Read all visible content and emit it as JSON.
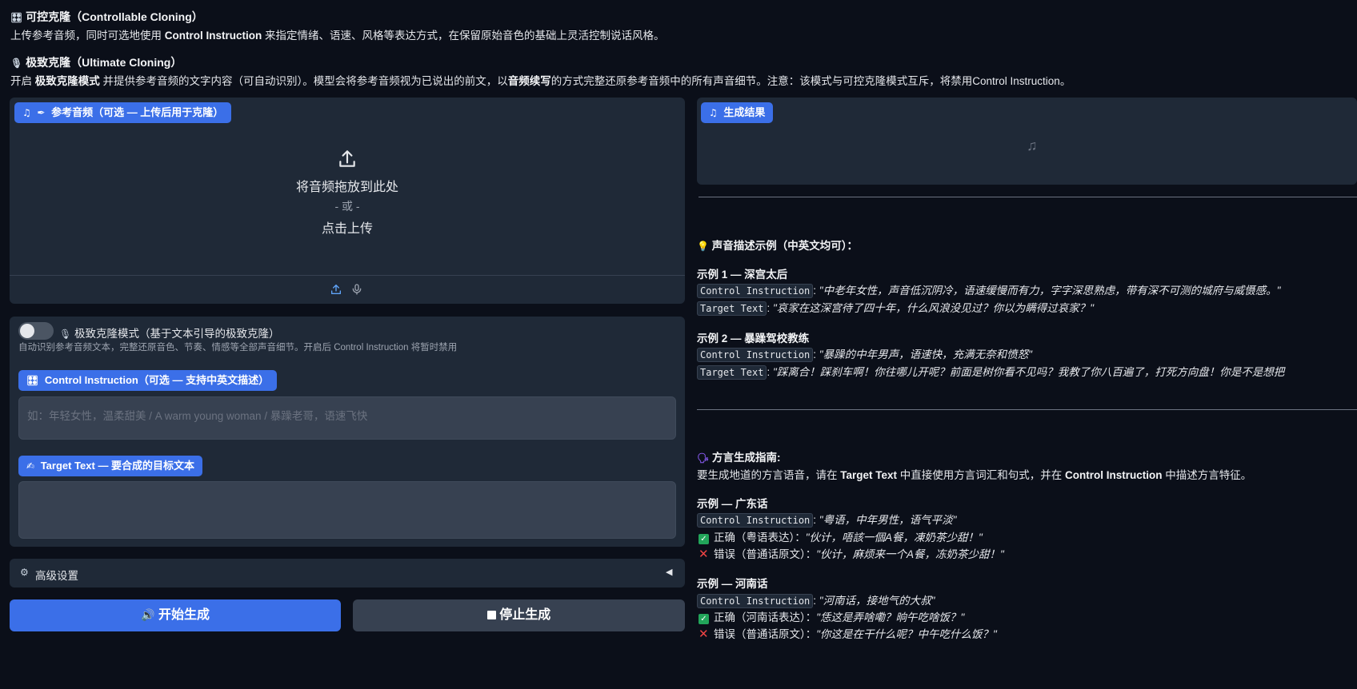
{
  "intro": {
    "controllable_title": "可控克隆（Controllable Cloning）",
    "controllable_desc_pre": "上传参考音频，同时可选地使用 ",
    "controllable_desc_bold": "Control Instruction",
    "controllable_desc_post": " 来指定情绪、语速、风格等表达方式，在保留原始音色的基础上灵活控制说话风格。",
    "ultimate_title": "极致克隆（Ultimate Cloning）",
    "ultimate_desc_pre": "开启 ",
    "ultimate_desc_bold1": "极致克隆模式",
    "ultimate_desc_mid": " 并提供参考音频的文字内容（可自动识别）。模型会将参考音频视为已说出的前文，以",
    "ultimate_desc_bold2": "音频续写",
    "ultimate_desc_post": "的方式完整还原参考音频中的所有声音细节。注意：该模式与可控克隆模式互斥，将禁用Control Instruction。"
  },
  "reference_audio": {
    "label": "参考音频（可选 — 上传后用于克隆）",
    "drop_text": "将音频拖放到此处",
    "or_text": "- 或 -",
    "click_text": "点击上传"
  },
  "ultimate_mode": {
    "label": "极致克隆模式（基于文本引导的极致克隆）",
    "hint": "自动识别参考音频文本，完整还原音色、节奏、情感等全部声音细节。开启后 Control Instruction 将暂时禁用",
    "enabled": false
  },
  "control_instruction": {
    "label": "Control Instruction（可选 — 支持中英文描述）",
    "placeholder": "如：年轻女性，温柔甜美 / A warm young woman / 暴躁老哥，语速飞快"
  },
  "target_text": {
    "label": "Target Text — 要合成的目标文本",
    "value": ""
  },
  "advanced": {
    "label": "高级设置"
  },
  "buttons": {
    "start": "开始生成",
    "stop": "停止生成"
  },
  "result": {
    "label": "生成结果"
  },
  "guide": {
    "examples_title": "声音描述示例（中英文均可）：",
    "ex1_title": "示例 1 — 深宫太后",
    "ci_tag": "Control Instruction",
    "tt_tag": "Target Text",
    "ex1_ci": "\"中老年女性，声音低沉阴冷，语速缓慢而有力，字字深思熟虑，带有深不可测的城府与威慑感。\"",
    "ex1_tt": "\"哀家在这深宫待了四十年，什么风浪没见过？你以为瞒得过哀家？\"",
    "ex2_title": "示例 2 — 暴躁驾校教练",
    "ex2_ci": "\"暴躁的中年男声，语速快，充满无奈和愤怒\"",
    "ex2_tt": "\"踩离合！踩刹车啊！你往哪儿开呢？前面是树你看不见吗？我教了你八百遍了，打死方向盘！你是不是想把",
    "dialect_title": "方言生成指南:",
    "dialect_desc_pre": "要生成地道的方言语音，请在 ",
    "dialect_desc_b1": "Target Text",
    "dialect_desc_mid": " 中直接使用方言词汇和句式，并在 ",
    "dialect_desc_b2": "Control Instruction",
    "dialect_desc_post": " 中描述方言特征。",
    "cant_title": "示例 — 广东话",
    "cant_ci": "\"粤语，中年男性，语气平淡\"",
    "cant_ok_label": "正确（粤语表达）：",
    "cant_ok": "\"伙计，唔該一個A餐，凍奶茶少甜！\"",
    "cant_bad_label": "错误（普通话原文）：",
    "cant_bad": "\"伙计，麻烦来一个A餐，冻奶茶少甜！\"",
    "henan_title": "示例 — 河南话",
    "henan_ci": "\"河南话，接地气的大叔\"",
    "henan_ok_label": "正确（河南话表达）：",
    "henan_ok": "\"恁这是弄啥嘞？晌午吃啥饭？\"",
    "henan_bad_label": "错误（普通话原文）：",
    "henan_bad": "\"你这是在干什么呢？中午吃什么饭？\""
  }
}
